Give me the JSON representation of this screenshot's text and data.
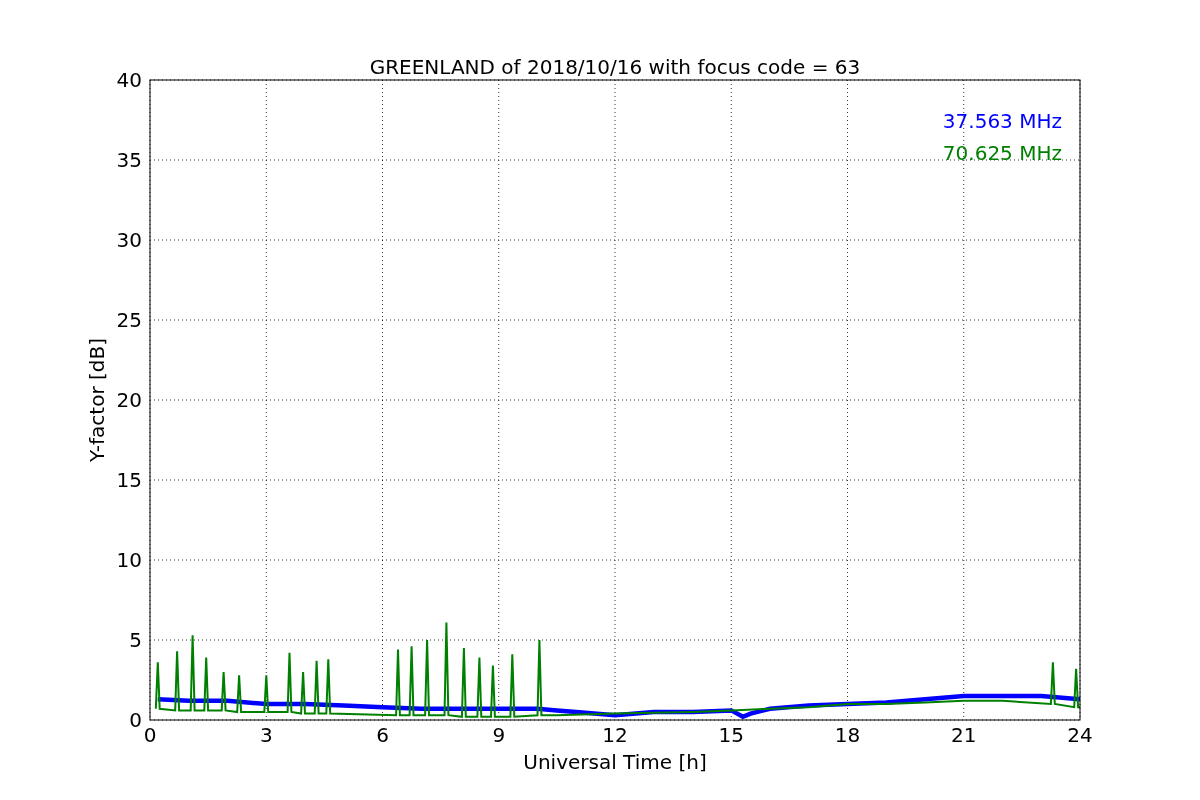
{
  "chart_data": {
    "type": "line",
    "grid": true,
    "title": "GREENLAND of 2018/10/16 with focus code = 63",
    "xlabel": "Universal Time [h]",
    "ylabel": "Y-factor [dB]",
    "xlim": [
      0,
      24
    ],
    "ylim": [
      0,
      40
    ],
    "xticks": [
      0,
      3,
      6,
      9,
      12,
      15,
      18,
      21,
      24
    ],
    "yticks": [
      0,
      5,
      10,
      15,
      20,
      25,
      30,
      35,
      40
    ],
    "series": [
      {
        "name": "37.563 MHz",
        "color": "#0000ff",
        "x": [
          0.2,
          1,
          2,
          3,
          4,
          5,
          6,
          7,
          8,
          9,
          10,
          10.5,
          11,
          12,
          13,
          14,
          15,
          15.3,
          15.5,
          16,
          17,
          18,
          19,
          20,
          21,
          22,
          23,
          24
        ],
        "values": [
          1.3,
          1.2,
          1.2,
          1.0,
          1.0,
          0.9,
          0.8,
          0.7,
          0.7,
          0.7,
          0.7,
          0.6,
          0.5,
          0.3,
          0.5,
          0.5,
          0.6,
          0.2,
          0.4,
          0.7,
          0.9,
          1.0,
          1.1,
          1.3,
          1.5,
          1.5,
          1.5,
          1.3
        ]
      },
      {
        "name": "70.625 MHz",
        "color": "#008000",
        "x": [
          0.15,
          0.2,
          0.25,
          0.65,
          0.7,
          0.75,
          1.05,
          1.1,
          1.15,
          1.4,
          1.45,
          1.5,
          1.85,
          1.9,
          1.95,
          2.25,
          2.3,
          2.35,
          2.95,
          3.0,
          3.05,
          3.55,
          3.6,
          3.65,
          3.9,
          3.95,
          4.0,
          4.25,
          4.3,
          4.35,
          4.55,
          4.6,
          4.65,
          6.35,
          6.4,
          6.45,
          6.7,
          6.75,
          6.8,
          7.1,
          7.15,
          7.2,
          7.6,
          7.65,
          7.7,
          8.05,
          8.1,
          8.15,
          8.45,
          8.5,
          8.55,
          8.8,
          8.85,
          8.9,
          9.3,
          9.35,
          9.4,
          10.0,
          10.05,
          10.1,
          10.5,
          12,
          14,
          15,
          16,
          17,
          18,
          19,
          20,
          21,
          22,
          23.25,
          23.3,
          23.35,
          23.85,
          23.9,
          23.95,
          24
        ],
        "values": [
          0.7,
          3.6,
          0.7,
          0.6,
          4.3,
          0.6,
          0.6,
          5.3,
          0.6,
          0.6,
          3.9,
          0.6,
          0.6,
          3.0,
          0.6,
          0.5,
          2.8,
          0.5,
          0.5,
          2.8,
          0.5,
          0.5,
          4.2,
          0.5,
          0.4,
          3.0,
          0.4,
          0.4,
          3.7,
          0.4,
          0.4,
          3.8,
          0.4,
          0.3,
          4.4,
          0.3,
          0.3,
          4.6,
          0.3,
          0.3,
          5.0,
          0.3,
          0.3,
          6.1,
          0.3,
          0.2,
          4.5,
          0.2,
          0.2,
          3.9,
          0.2,
          0.2,
          3.4,
          0.2,
          0.2,
          4.1,
          0.2,
          0.3,
          5.0,
          0.3,
          0.3,
          0.4,
          0.5,
          0.6,
          0.7,
          0.8,
          1.0,
          1.0,
          1.1,
          1.2,
          1.2,
          1.0,
          3.6,
          1.0,
          0.8,
          3.2,
          0.8,
          0.8
        ]
      }
    ]
  }
}
